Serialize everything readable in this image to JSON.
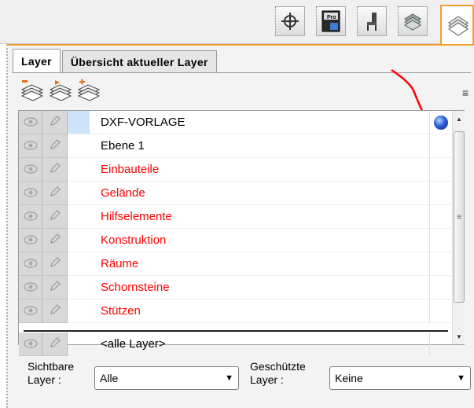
{
  "toolbar": {
    "buttons": [
      {
        "icon": "crosshair-icon"
      },
      {
        "icon": "pro-icon",
        "label": "Pro"
      },
      {
        "icon": "chair-icon"
      },
      {
        "icon": "layers-stack-icon"
      },
      {
        "icon": "layers-icon",
        "active": true
      }
    ]
  },
  "tabs": [
    {
      "label": "Layer",
      "active": true
    },
    {
      "label": "Übersicht aktueller Layer",
      "active": false
    }
  ],
  "layer_tools": [
    {
      "icon": "layer-remove-icon"
    },
    {
      "icon": "layer-move-icon"
    },
    {
      "icon": "layer-add-icon"
    }
  ],
  "menu_icon": "≡",
  "layers": [
    {
      "name": "DXF-VORLAGE",
      "color": "#000000",
      "selected": true,
      "current": true
    },
    {
      "name": "Ebene 1",
      "color": "#000000"
    },
    {
      "name": "Einbauteile",
      "color": "#ff0000"
    },
    {
      "name": "Gelände",
      "color": "#ff0000"
    },
    {
      "name": "Hilfselemente",
      "color": "#ff0000"
    },
    {
      "name": "Konstruktion",
      "color": "#ff0000"
    },
    {
      "name": "Räume",
      "color": "#ff0000"
    },
    {
      "name": "Schornsteine",
      "color": "#ff0000"
    },
    {
      "name": "Stützen",
      "color": "#ff0000"
    }
  ],
  "all_layers_row": "<alle Layer>",
  "filters": {
    "visible_label": "Sichtbare\nLayer :",
    "visible_line1": "Sichtbare",
    "visible_line2": "Layer :",
    "visible_value": "Alle",
    "protected_line1": "Geschützte",
    "protected_line2": "Layer :",
    "protected_value": "Keine"
  },
  "colors": {
    "accent": "#f0a030",
    "red_layer": "#ff0000",
    "current_dot": "#2e63d8",
    "annotation": "#ff0000"
  }
}
